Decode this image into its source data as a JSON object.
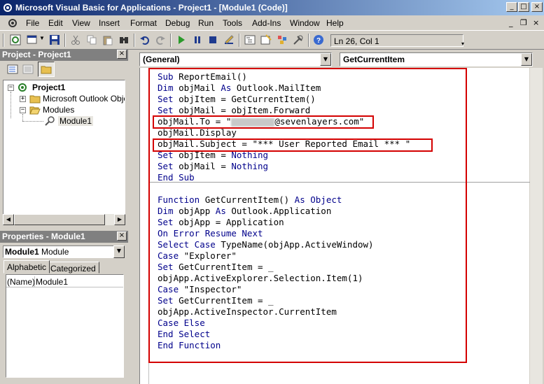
{
  "window": {
    "title": "Microsoft Visual Basic for Applications - Project1 - [Module1 (Code)]",
    "min_glyph": "_",
    "max_glyph": "□",
    "close_glyph": "×"
  },
  "menu": {
    "items": [
      {
        "label": "File",
        "key": "F"
      },
      {
        "label": "Edit",
        "key": "E"
      },
      {
        "label": "View",
        "key": "V"
      },
      {
        "label": "Insert",
        "key": "I"
      },
      {
        "label": "Format",
        "key": "o"
      },
      {
        "label": "Debug",
        "key": "D"
      },
      {
        "label": "Run",
        "key": "R"
      },
      {
        "label": "Tools",
        "key": "T"
      },
      {
        "label": "Add-Ins",
        "key": "A"
      },
      {
        "label": "Window",
        "key": "W"
      },
      {
        "label": "Help",
        "key": "H"
      }
    ],
    "mdi_min": "_",
    "mdi_restore": "❐",
    "mdi_close": "×"
  },
  "toolbar": {
    "position_text": "Ln 26, Col 1",
    "icons": [
      "vba-project-icon",
      "insert-userform-icon",
      "save-icon",
      "cut-icon",
      "copy-icon",
      "paste-icon",
      "find-icon",
      "undo-icon",
      "redo-icon",
      "run-icon",
      "break-icon",
      "reset-icon",
      "design-mode-icon",
      "project-explorer-icon",
      "properties-icon",
      "object-browser-icon",
      "toolbox-icon",
      "help-icon"
    ]
  },
  "project_panel": {
    "title": "Project - Project1",
    "tree": {
      "root": "Project1",
      "folder1": "Microsoft Outlook Objects",
      "folder2": "Modules",
      "module": "Module1"
    }
  },
  "properties_panel": {
    "title": "Properties - Module1",
    "object_bold": "Module1",
    "object_type": "Module",
    "tabs": [
      "Alphabetic",
      "Categorized"
    ],
    "row_name": "(Name)",
    "row_value": "Module1"
  },
  "code_window": {
    "object_combo": "(General)",
    "procedure_combo": "GetCurrentItem",
    "proc1": [
      {
        "kw": "Sub ",
        "rest": "ReportEmail()"
      },
      {
        "kw": "Dim ",
        "rest": "objMail ",
        "kw2": "As ",
        "rest2": "Outlook.MailItem"
      },
      {
        "kw": "Set ",
        "rest": "objItem = GetCurrentItem()"
      },
      {
        "kw": "Set ",
        "rest": "objMail = objItem.Forward"
      },
      {
        "kw": "",
        "rest": "objMail.To = \"",
        "redacted": true,
        "rest2": "@sevenlayers.com\""
      },
      {
        "kw": "",
        "rest": "objMail.Display"
      },
      {
        "kw": "",
        "rest": "objMail.Subject = \"*** User Reported Email *** \""
      },
      {
        "kw": "Set ",
        "rest": "objItem = ",
        "kw2": "Nothing"
      },
      {
        "kw": "Set ",
        "rest": "objMail = ",
        "kw2": "Nothing"
      },
      {
        "kw": "End Sub",
        "rest": ""
      }
    ],
    "proc2": [
      {
        "kw": "Function ",
        "rest": "GetCurrentItem() ",
        "kw2": "As Object"
      },
      {
        "kw": "Dim ",
        "rest": "objApp ",
        "kw2": "As ",
        "rest2": "Outlook.Application"
      },
      {
        "kw": "Set ",
        "rest": "objApp = Application"
      },
      {
        "kw": "On Error Resume Next",
        "rest": ""
      },
      {
        "kw": "Select Case ",
        "rest": "TypeName(objApp.ActiveWindow)"
      },
      {
        "kw": "Case ",
        "rest": "\"Explorer\""
      },
      {
        "kw": "Set ",
        "rest": "GetCurrentItem = _"
      },
      {
        "kw": "",
        "rest": "objApp.ActiveExplorer.Selection.Item(1)"
      },
      {
        "kw": "Case ",
        "rest": "\"Inspector\""
      },
      {
        "kw": "Set ",
        "rest": "GetCurrentItem = _"
      },
      {
        "kw": "",
        "rest": "objApp.ActiveInspector.CurrentItem"
      },
      {
        "kw": "Case Else",
        "rest": ""
      },
      {
        "kw": "End Select",
        "rest": ""
      },
      {
        "kw": "End Function",
        "rest": ""
      }
    ]
  },
  "colors": {
    "keyword": "#00008b",
    "highlight_box": "#d40000",
    "title_bar_start": "#0a246a"
  }
}
